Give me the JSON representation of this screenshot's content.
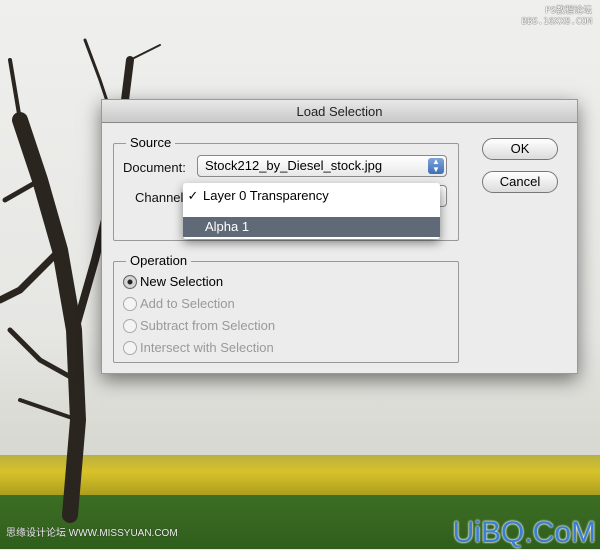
{
  "watermarks": {
    "top_right_line1": "PS教程论坛",
    "top_right_line2": "BBS.16XX8.COM",
    "bottom_left": "思缘设计论坛 WWW.MISSYUAN.COM",
    "bottom_right": "UiBQ.CoM"
  },
  "dialog": {
    "title": "Load Selection",
    "source": {
      "legend": "Source",
      "document_label": "Document:",
      "document_value": "Stock212_by_Diesel_stock.jpg",
      "channel_label": "Channel:",
      "channel_menu": [
        {
          "label": "Layer 0 Transparency",
          "checked": true
        },
        {
          "label": "Alpha 1",
          "highlighted": true
        }
      ]
    },
    "operation": {
      "legend": "Operation",
      "options": [
        {
          "label": "New Selection",
          "selected": true,
          "enabled": true
        },
        {
          "label": "Add to Selection",
          "enabled": false
        },
        {
          "label": "Subtract from Selection",
          "enabled": false
        },
        {
          "label": "Intersect with Selection",
          "enabled": false
        }
      ]
    },
    "ok_label": "OK",
    "cancel_label": "Cancel"
  },
  "checkmark": "✓"
}
